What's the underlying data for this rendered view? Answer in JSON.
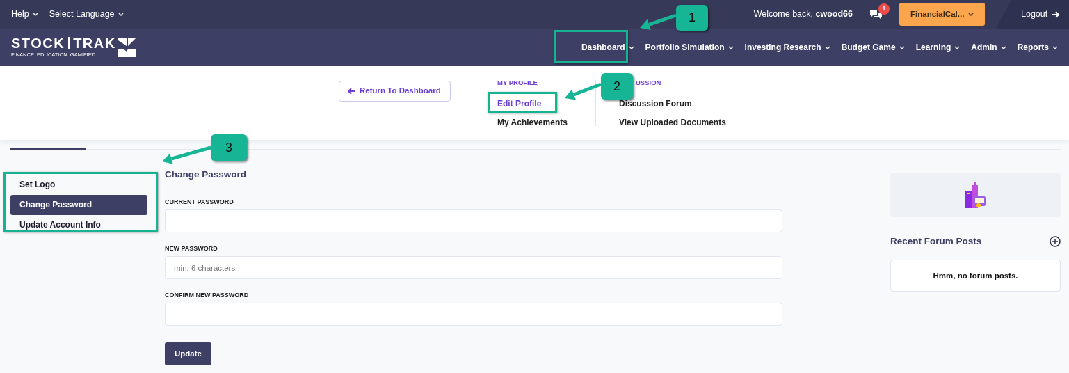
{
  "top_bar": {
    "help": "Help",
    "language": "Select Language",
    "welcome": "Welcome back, **cwood66**",
    "notification_count": "1",
    "account": "FinancialCal...",
    "logout": "Logout"
  },
  "brand": {
    "name_left": "STOCK",
    "name_right": "TRAK",
    "tagline": "FINANCE. EDUCATION. GAMIFIED."
  },
  "nav": [
    "Dashboard",
    "Portfolio Simulation",
    "Investing Research",
    "Budget Game",
    "Learning",
    "Admin",
    "Reports"
  ],
  "subnav": {
    "return_button": "Return To Dashboard",
    "sections": [
      {
        "heading": "MY PROFILE",
        "links": [
          {
            "label": "Edit Profile",
            "selected": true
          },
          {
            "label": "My Achievements",
            "selected": false
          }
        ]
      },
      {
        "heading": "USSION",
        "links": [
          {
            "label": "Discussion Forum",
            "selected": false
          },
          {
            "label": "View Uploaded Documents",
            "selected": false
          }
        ]
      }
    ]
  },
  "sidebar": {
    "items": [
      {
        "label": "Set Logo",
        "selected": false
      },
      {
        "label": "Change Password",
        "selected": true
      },
      {
        "label": "Update Account Info",
        "selected": false
      }
    ]
  },
  "form": {
    "title": "Change Password",
    "fields": [
      {
        "label": "CURRENT PASSWORD"
      },
      {
        "label": "NEW PASSWORD",
        "placeholder": "min. 6 characters"
      },
      {
        "label": "CONFIRM NEW PASSWORD"
      }
    ],
    "button": "Update"
  },
  "right_panel": {
    "title": "Recent Forum Posts",
    "empty_text": "Hmm, no forum posts."
  },
  "annotations": [
    {
      "number": "1"
    },
    {
      "number": "2"
    },
    {
      "number": "3"
    }
  ]
}
